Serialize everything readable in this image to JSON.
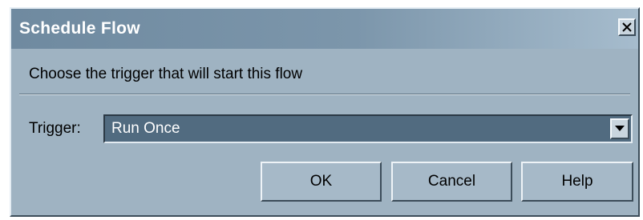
{
  "window": {
    "title": "Schedule Flow",
    "close_icon": "close-icon"
  },
  "prompt": "Choose the trigger that will start this flow",
  "trigger": {
    "label": "Trigger:",
    "selected": "Run Once",
    "dropdown_icon": "chevron-down-icon"
  },
  "buttons": {
    "ok": "OK",
    "cancel": "Cancel",
    "help": "Help"
  },
  "colors": {
    "dialog_bg": "#9fb3c2",
    "titlebar_start": "#6f8aa0",
    "titlebar_end": "#a6bccd",
    "select_bg": "#516b80"
  }
}
